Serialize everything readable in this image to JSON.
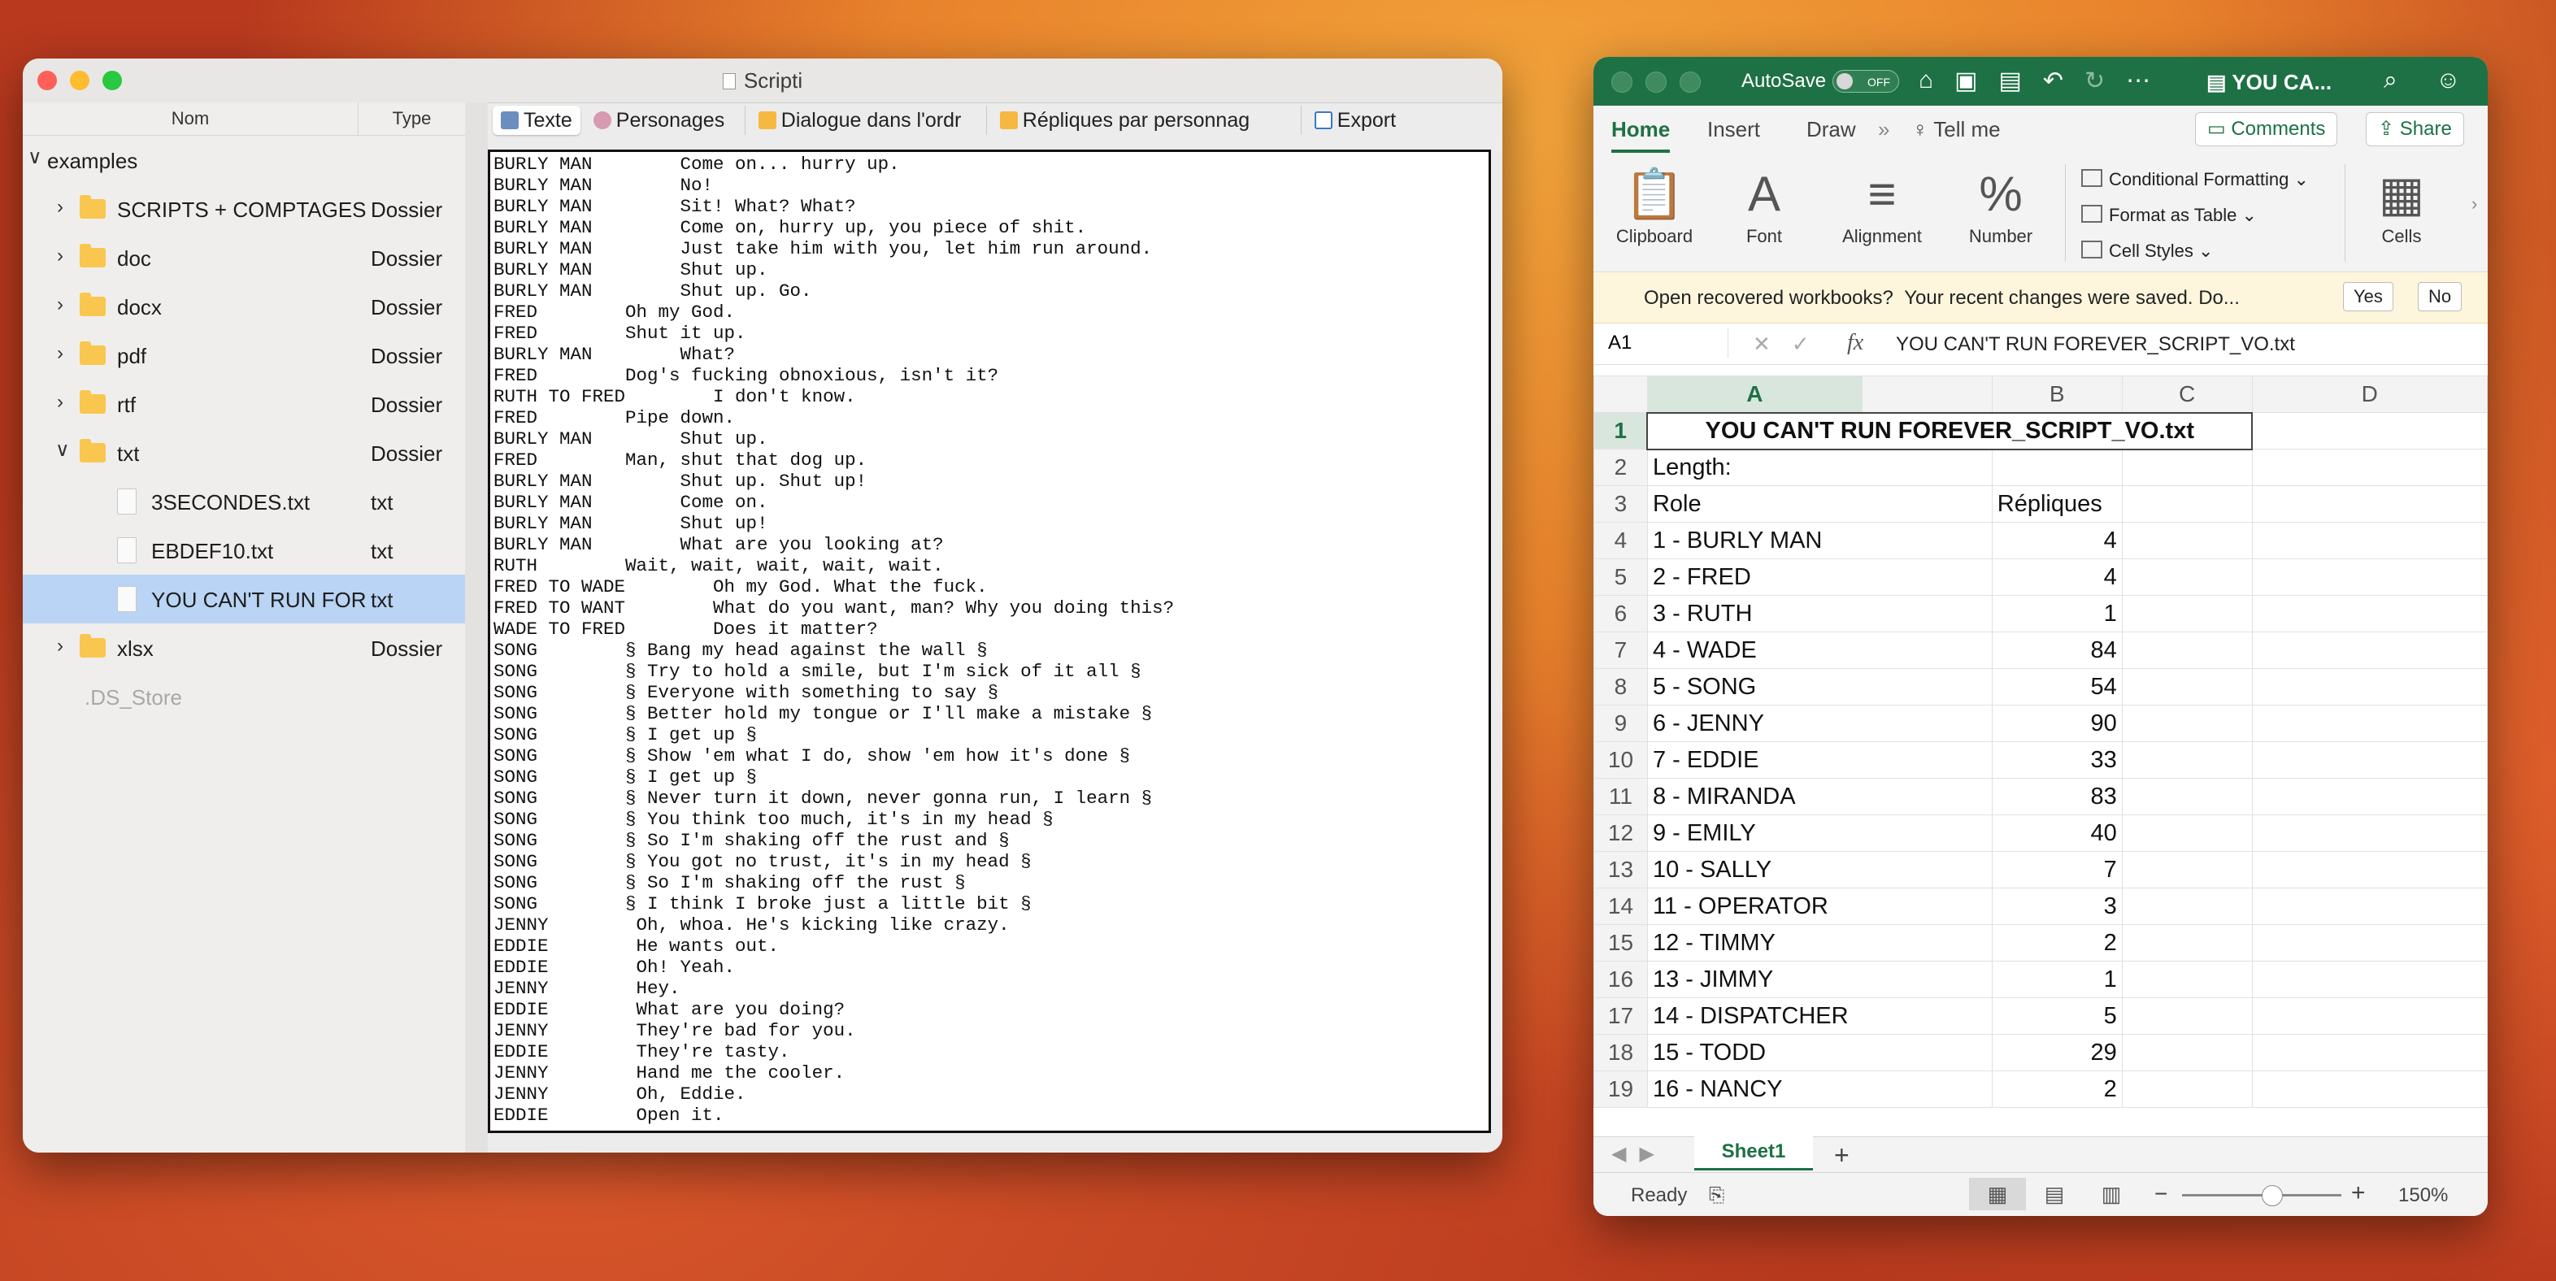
{
  "scripti": {
    "title": "Scripti",
    "columns": {
      "name": "Nom",
      "type": "Type"
    },
    "root": "examples",
    "tree": [
      {
        "label": "SCRIPTS + COMPTAGES",
        "type": "Dossier"
      },
      {
        "label": "doc",
        "type": "Dossier"
      },
      {
        "label": "docx",
        "type": "Dossier"
      },
      {
        "label": "pdf",
        "type": "Dossier"
      },
      {
        "label": "rtf",
        "type": "Dossier"
      },
      {
        "label": "txt",
        "type": "Dossier"
      },
      {
        "label": "3SECONDES.txt",
        "type": "txt"
      },
      {
        "label": "EBDEF10.txt",
        "type": "txt"
      },
      {
        "label": "YOU CAN'T RUN FOR",
        "type": "txt"
      },
      {
        "label": "xlsx",
        "type": "Dossier"
      },
      {
        "label": ".DS_Store",
        "type": ""
      }
    ],
    "tabs": [
      "Texte",
      "Personages",
      "Dialogue dans l'ordr",
      "Répliques par personnag",
      "Export"
    ],
    "script_text": "BURLY MAN        Come on... hurry up.\nBURLY MAN        No!\nBURLY MAN        Sit! What? What?\nBURLY MAN        Come on, hurry up, you piece of shit.\nBURLY MAN        Just take him with you, let him run around.\nBURLY MAN        Shut up.\nBURLY MAN        Shut up. Go.\nFRED        Oh my God.\nFRED        Shut it up.\nBURLY MAN        What?\nFRED        Dog's fucking obnoxious, isn't it?\nRUTH TO FRED        I don't know.\nFRED        Pipe down.\nBURLY MAN        Shut up.\nFRED        Man, shut that dog up.\nBURLY MAN        Shut up. Shut up!\nBURLY MAN        Come on.\nBURLY MAN        Shut up!\nBURLY MAN        What are you looking at?\nRUTH        Wait, wait, wait, wait, wait.\nFRED TO WADE        Oh my God. What the fuck.\nFRED TO WANT        What do you want, man? Why you doing this?\nWADE TO FRED        Does it matter?\nSONG        § Bang my head against the wall §\nSONG        § Try to hold a smile, but I'm sick of it all §\nSONG        § Everyone with something to say §\nSONG        § Better hold my tongue or I'll make a mistake §\nSONG        § I get up §\nSONG        § Show 'em what I do, show 'em how it's done §\nSONG        § I get up §\nSONG        § Never turn it down, never gonna run, I learn §\nSONG        § You think too much, it's in my head §\nSONG        § So I'm shaking off the rust and §\nSONG        § You got no trust, it's in my head §\nSONG        § So I'm shaking off the rust §\nSONG        § I think I broke just a little bit §\nJENNY        Oh, whoa. He's kicking like crazy.\nEDDIE        He wants out.\nEDDIE        Oh! Yeah.\nJENNY        Hey.\nEDDIE        What are you doing?\nJENNY        They're bad for you.\nEDDIE        They're tasty.\nJENNY        Hand me the cooler.\nJENNY        Oh, Eddie.\nEDDIE        Open it."
  },
  "excel": {
    "autosave": "AutoSave",
    "toggle": "OFF",
    "filename": "YOU CA...",
    "tabs": [
      "Home",
      "Insert",
      "Draw"
    ],
    "tell_me": "Tell me",
    "comments": "Comments",
    "share": "Share",
    "ribbon": {
      "clipboard": "Clipboard",
      "font": "Font",
      "alignment": "Alignment",
      "number": "Number",
      "cond_format": "Conditional Formatting",
      "format_table": "Format as Table",
      "cell_styles": "Cell Styles",
      "cells": "Cells"
    },
    "infobar": {
      "title": "Open recovered workbooks?",
      "message": "Your recent changes were saved. Do...",
      "yes": "Yes",
      "no": "No"
    },
    "namebox": "A1",
    "formula": "YOU CAN'T RUN FOREVER_SCRIPT_VO.txt",
    "col_headers": [
      "A",
      "B",
      "C",
      "D"
    ],
    "title_cell": "YOU CAN'T RUN FOREVER_SCRIPT_VO.txt",
    "length_label": "Length:",
    "header_role": "Role",
    "header_count": "Répliques",
    "rows": [
      {
        "role": "1 - BURLY MAN",
        "count": "4"
      },
      {
        "role": "2 - FRED",
        "count": "4"
      },
      {
        "role": "3 - RUTH",
        "count": "1"
      },
      {
        "role": "4 - WADE",
        "count": "84"
      },
      {
        "role": "5 - SONG",
        "count": "54"
      },
      {
        "role": "6 - JENNY",
        "count": "90"
      },
      {
        "role": "7 - EDDIE",
        "count": "33"
      },
      {
        "role": "8 - MIRANDA",
        "count": "83"
      },
      {
        "role": "9 - EMILY",
        "count": "40"
      },
      {
        "role": "10 - SALLY",
        "count": "7"
      },
      {
        "role": "11 - OPERATOR",
        "count": "3"
      },
      {
        "role": "12 - TIMMY",
        "count": "2"
      },
      {
        "role": "13 - JIMMY",
        "count": "1"
      },
      {
        "role": "14 - DISPATCHER",
        "count": "5"
      },
      {
        "role": "15 - TODD",
        "count": "29"
      },
      {
        "role": "16 - NANCY",
        "count": "2"
      }
    ],
    "sheet": "Sheet1",
    "status": "Ready",
    "zoom": "150%"
  }
}
